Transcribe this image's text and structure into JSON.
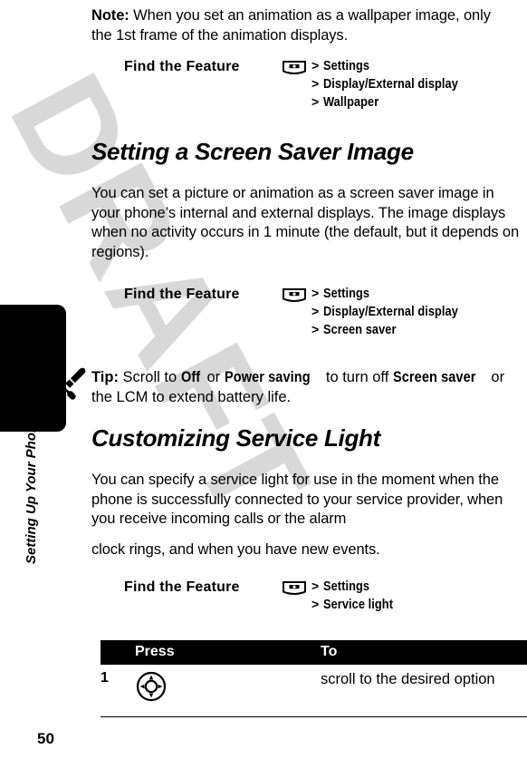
{
  "document": {
    "page_number": "50",
    "watermark_text": "DRAFT",
    "side_tab_label": "Setting Up Your Phone",
    "watermark_color": "#d8d8d8"
  },
  "note": {
    "lead": "Note:",
    "text": " When you set an animation as a wallpaper image, only the 1st frame of the animation displays."
  },
  "find_feature_1": {
    "label": "Find the Feature",
    "icon": "menu-key-icon",
    "path": [
      {
        "sep": ">",
        "item": "Settings"
      },
      {
        "sep": ">",
        "item": "Display/External display"
      },
      {
        "sep": ">",
        "item": "Wallpaper"
      }
    ]
  },
  "section_screen_saver": {
    "heading": "Setting a Screen Saver Image",
    "body": "You can set a picture or animation as a screen saver image in your phone’s internal and external displays. The image displays when no activity occurs in 1 minute (the default, but it depends on regions)."
  },
  "find_feature_2": {
    "label": "Find the Feature",
    "icon": "menu-key-icon",
    "path": [
      {
        "sep": ">",
        "item": "Settings"
      },
      {
        "sep": ">",
        "item": "Display/External display"
      },
      {
        "sep": ">",
        "item": "Screen saver"
      }
    ]
  },
  "tip": {
    "icon": "wrench-screwdriver-icon",
    "lead": "Tip:",
    "part1": " Scroll to ",
    "bold1": "Off",
    "part2": " or ",
    "bold2": "Power saving",
    "part3": " to turn off ",
    "bold3": "Screen saver",
    "part4": " or the LCM to extend battery life."
  },
  "section_service_light": {
    "heading": "Customizing Service Light",
    "body_line1": "You can specify a service light for use in the moment when the phone is successfully connected to your service provider, when you receive incoming calls or the alarm",
    "body_line2": "clock rings, and when you have new events."
  },
  "find_feature_3": {
    "label": "Find the Feature",
    "icon": "menu-key-icon",
    "path": [
      {
        "sep": ">",
        "item": "Settings"
      },
      {
        "sep": ">",
        "item": "Service light"
      }
    ]
  },
  "steps_table": {
    "headers": {
      "num": "",
      "press": "Press",
      "to": "To"
    },
    "rows": [
      {
        "num": "1",
        "key_icon": "navigation-key-icon",
        "to": "scroll to the desired option"
      }
    ]
  }
}
